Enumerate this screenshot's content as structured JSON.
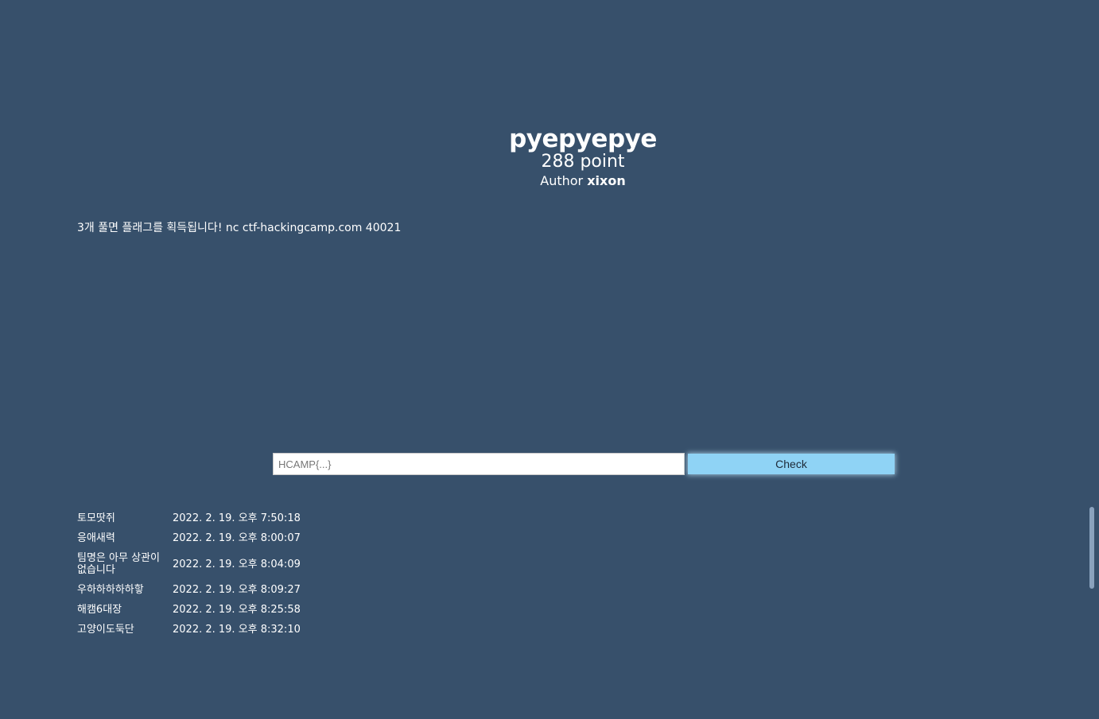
{
  "challenge": {
    "title": "pyepyepye",
    "points": "288 point",
    "author_label": "Author",
    "author_name": "xixon",
    "description": "3개 풀면 플래그를 획득됩니다! nc ctf-hackingcamp.com 40021"
  },
  "flag_form": {
    "placeholder": "HCAMP{...}",
    "value": "",
    "check_label": "Check"
  },
  "solvers": [
    {
      "team": "토모땃쥐",
      "time": "2022. 2. 19. 오후 7:50:18"
    },
    {
      "team": "응애새력",
      "time": "2022. 2. 19. 오후 8:00:07"
    },
    {
      "team": "팀명은 아무 상관이 없습니다",
      "time": "2022. 2. 19. 오후 8:04:09"
    },
    {
      "team": "우하하하하하핳",
      "time": "2022. 2. 19. 오후 8:09:27"
    },
    {
      "team": "해캠6대장",
      "time": "2022. 2. 19. 오후 8:25:58"
    },
    {
      "team": "고양이도둑단",
      "time": "2022. 2. 19. 오후 8:32:10"
    }
  ],
  "colors": {
    "background": "#37506b",
    "button": "#8fd3f5"
  }
}
